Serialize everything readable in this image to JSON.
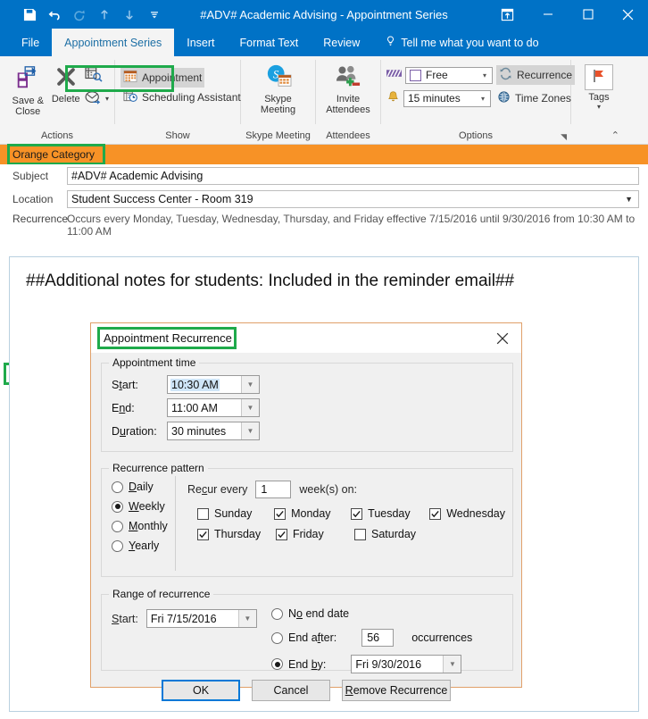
{
  "window": {
    "title": "#ADV# Academic Advising - Appointment Series",
    "qat": [
      {
        "name": "save-icon",
        "label": "Save"
      },
      {
        "name": "undo-icon",
        "label": "Undo"
      },
      {
        "name": "redo-icon",
        "label": "Redo"
      },
      {
        "name": "previous-item-icon",
        "label": "Previous Item"
      },
      {
        "name": "next-item-icon",
        "label": "Next Item"
      },
      {
        "name": "customize-quick-access-toolbar-icon",
        "label": "Customize Quick Access Toolbar"
      }
    ],
    "controls": [
      {
        "name": "ribbon-display-options-icon",
        "label": "Ribbon Display Options"
      },
      {
        "name": "minimize-icon",
        "label": "Minimize"
      },
      {
        "name": "maximize-icon",
        "label": "Maximize"
      },
      {
        "name": "close-icon",
        "label": "Close"
      }
    ]
  },
  "tabs": [
    {
      "label": "File",
      "active": false
    },
    {
      "label": "Appointment Series",
      "active": true
    },
    {
      "label": "Insert",
      "active": false
    },
    {
      "label": "Format Text",
      "active": false
    },
    {
      "label": "Review",
      "active": false
    },
    {
      "label": "Tell me what you want to do",
      "active": false
    }
  ],
  "ribbon": {
    "groups": {
      "actions": {
        "label": "Actions",
        "save_close": "Save &\nClose",
        "save_close_line1": "Save &",
        "save_close_line2": "Close",
        "delete": "Delete",
        "forward_tooltip": "Forward"
      },
      "show": {
        "label": "Show",
        "appointment": "Appointment",
        "scheduling_assistant": "Scheduling Assistant"
      },
      "skype": {
        "label": "Skype Meeting",
        "button_line1": "Skype",
        "button_line2": "Meeting"
      },
      "attendees": {
        "label": "Attendees",
        "button_line1": "Invite",
        "button_line2": "Attendees"
      },
      "options": {
        "label": "Options",
        "show_as_value": "Free",
        "reminder_value": "15 minutes",
        "recurrence": "Recurrence",
        "time_zones": "Time Zones"
      },
      "tags": {
        "label": "Tags"
      }
    }
  },
  "form": {
    "category_label": "Orange Category",
    "subject_label": "Subject",
    "subject_value": "#ADV# Academic Advising",
    "location_label": "Location",
    "location_value": "Student Success Center - Room 319",
    "recurrence_label": "Recurrence",
    "recurrence_value": "Occurs every Monday, Tuesday, Wednesday, Thursday, and Friday effective 7/15/2016 until 9/30/2016 from 10:30 AM to 11:00 AM",
    "notes_body": "##Additional notes for students: Included in the reminder email##"
  },
  "dialog": {
    "title": "Appointment Recurrence",
    "close_label": "Close",
    "appointment_time": {
      "legend": "Appointment time",
      "start_label": "Start:",
      "start_value": "10:30 AM",
      "end_label": "End:",
      "end_value": "11:00 AM",
      "duration_label": "Duration:",
      "duration_value": "30 minutes"
    },
    "recurrence_pattern": {
      "legend": "Recurrence pattern",
      "options": [
        {
          "label": "Daily",
          "selected": false
        },
        {
          "label": "Weekly",
          "selected": true
        },
        {
          "label": "Monthly",
          "selected": false
        },
        {
          "label": "Yearly",
          "selected": false
        }
      ],
      "recur_every_label": "Recur every",
      "recur_every_value": "1",
      "weeks_on_label": "week(s) on:",
      "days": [
        {
          "label": "Sunday",
          "checked": false
        },
        {
          "label": "Monday",
          "checked": true
        },
        {
          "label": "Tuesday",
          "checked": true
        },
        {
          "label": "Wednesday",
          "checked": true
        },
        {
          "label": "Thursday",
          "checked": true
        },
        {
          "label": "Friday",
          "checked": true
        },
        {
          "label": "Saturday",
          "checked": false
        }
      ]
    },
    "range": {
      "legend": "Range of recurrence",
      "start_label": "Start:",
      "start_value": "Fri 7/15/2016",
      "no_end_date_label": "No end date",
      "no_end_date_selected": false,
      "end_after_label": "End after:",
      "end_after_selected": false,
      "end_after_value": "56",
      "occurrences_label": "occurrences",
      "end_by_label": "End by:",
      "end_by_selected": true,
      "end_by_value": "Fri 9/30/2016"
    },
    "buttons": {
      "ok": "OK",
      "cancel": "Cancel",
      "remove": "Remove Recurrence"
    }
  },
  "annotations": {
    "highlight_color": "#1faa4b",
    "arrow_color": "#e01b1b",
    "category_color": "#f79226",
    "accent_color": "#0072c6"
  }
}
